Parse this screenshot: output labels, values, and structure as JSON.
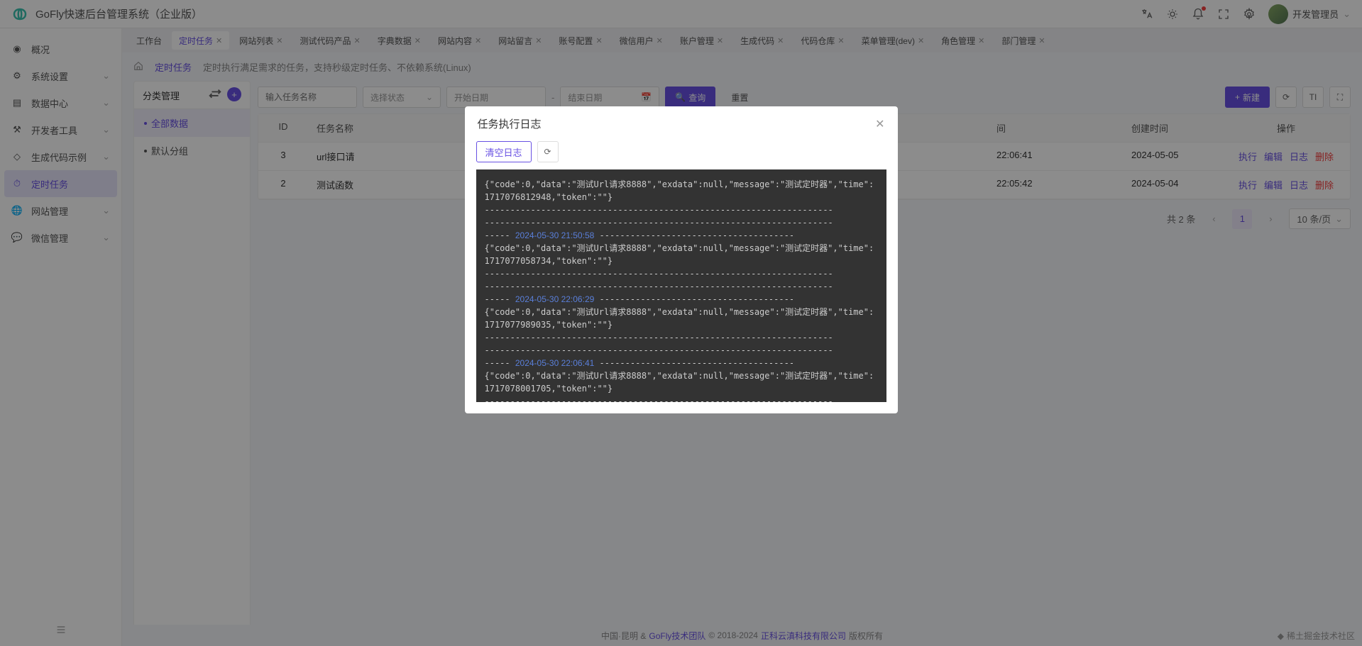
{
  "header": {
    "title": "GoFly快速后台管理系统（企业版）",
    "user": "开发管理员"
  },
  "sidebar": {
    "items": [
      {
        "label": "概况"
      },
      {
        "label": "系统设置",
        "chev": true
      },
      {
        "label": "数据中心",
        "chev": true
      },
      {
        "label": "开发者工具",
        "chev": true
      },
      {
        "label": "生成代码示例",
        "chev": true
      },
      {
        "label": "定时任务",
        "active": true
      },
      {
        "label": "网站管理",
        "chev": true
      },
      {
        "label": "微信管理",
        "chev": true
      }
    ]
  },
  "tabs": {
    "items": [
      {
        "label": "工作台"
      },
      {
        "label": "定时任务",
        "active": true,
        "close": true
      },
      {
        "label": "网站列表",
        "close": true
      },
      {
        "label": "测试代码产品",
        "close": true
      },
      {
        "label": "字典数据",
        "close": true
      },
      {
        "label": "网站内容",
        "close": true
      },
      {
        "label": "网站留言",
        "close": true
      },
      {
        "label": "账号配置",
        "close": true
      },
      {
        "label": "微信用户",
        "close": true
      },
      {
        "label": "账户管理",
        "close": true
      },
      {
        "label": "生成代码",
        "close": true
      },
      {
        "label": "代码仓库",
        "close": true
      },
      {
        "label": "菜单管理(dev)",
        "close": true
      },
      {
        "label": "角色管理",
        "close": true
      },
      {
        "label": "部门管理",
        "close": true
      }
    ]
  },
  "breadcrumb": {
    "current": "定时任务",
    "desc": "定时执行满足需求的任务，支持秒级定时任务、不依赖系统(Linux)"
  },
  "panel": {
    "title": "分类管理",
    "items": [
      {
        "label": "全部数据",
        "active": true
      },
      {
        "label": "默认分组"
      }
    ]
  },
  "toolbar": {
    "search_placeholder": "输入任务名称",
    "select_placeholder": "选择状态",
    "date_start": "开始日期",
    "date_end": "结束日期",
    "search": "查询",
    "reset": "重置",
    "new": "新建"
  },
  "table": {
    "cols": {
      "id": "ID",
      "name": "任务名称",
      "t1": "间",
      "t2": "创建时间",
      "actions": "操作"
    },
    "rows": [
      {
        "id": "3",
        "name": "url接口请",
        "t1": "22:06:41",
        "t2": "2024-05-05"
      },
      {
        "id": "2",
        "name": "测试函数",
        "t1": "22:05:42",
        "t2": "2024-05-04"
      }
    ],
    "actions": {
      "exec": "执行",
      "edit": "编辑",
      "log": "日志",
      "del": "删除"
    }
  },
  "pagination": {
    "total": "共 2 条",
    "page": "1",
    "size": "10 条/页"
  },
  "footer": {
    "p1": "中国·昆明 & ",
    "a1": "GoFly技术团队",
    "p2": " © 2018-2024 ",
    "a2": "正科云滇科技有限公司",
    "p3": " 版权所有"
  },
  "watermark": "稀土掘金技术社区",
  "modal": {
    "title": "任务执行日志",
    "clear": "清空日志",
    "logs": [
      {
        "body": "{\"code\":0,\"data\":\"测试Url请求8888\",\"exdata\":null,\"message\":\"测试定时器\",\"time\":1717076812948,\"token\":\"\"}"
      },
      {
        "ts": "2024-05-30 21:50:58",
        "body": "{\"code\":0,\"data\":\"测试Url请求8888\",\"exdata\":null,\"message\":\"测试定时器\",\"time\":1717077058734,\"token\":\"\"}"
      },
      {
        "ts": "2024-05-30 22:06:29",
        "body": "{\"code\":0,\"data\":\"测试Url请求8888\",\"exdata\":null,\"message\":\"测试定时器\",\"time\":1717077989035,\"token\":\"\"}"
      },
      {
        "ts": "2024-05-30 22:06:41",
        "body": "{\"code\":0,\"data\":\"测试Url请求8888\",\"exdata\":null,\"message\":\"测试定时器\",\"time\":1717078001705,\"token\":\"\"}"
      }
    ]
  }
}
